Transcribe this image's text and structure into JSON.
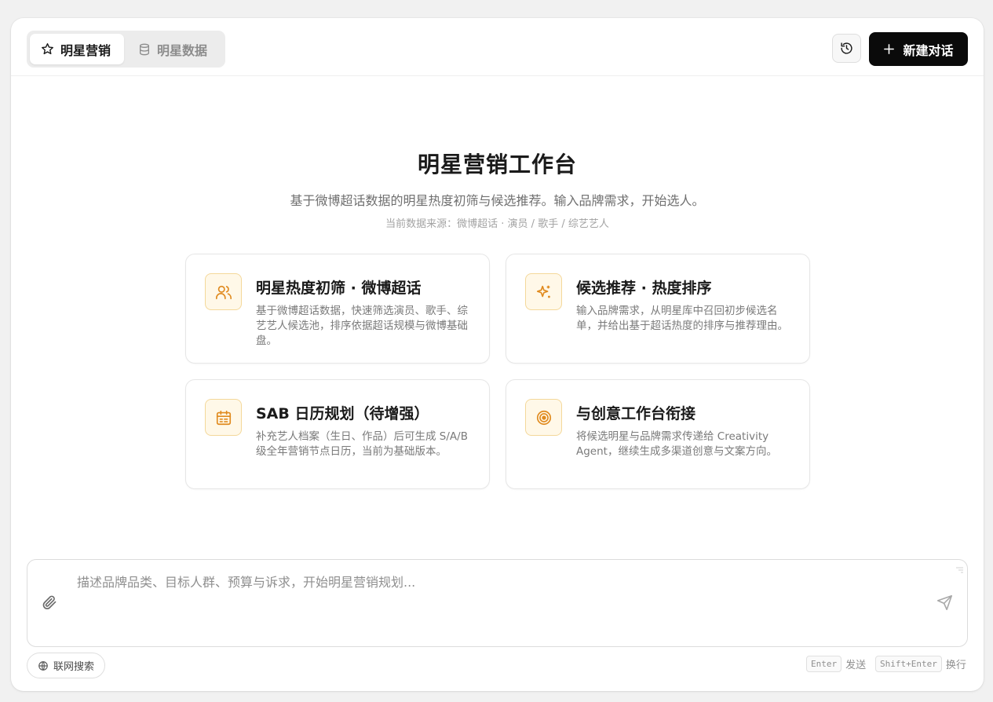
{
  "tabs": [
    {
      "label": "明星营销",
      "icon": "star-icon",
      "active": true
    },
    {
      "label": "明星数据",
      "icon": "database-icon",
      "active": false
    }
  ],
  "header": {
    "history_icon": "history-icon",
    "new_chat_label": "新建对话"
  },
  "hero": {
    "title": "明星营销工作台",
    "subtitle": "基于微博超话数据的明星热度初筛与候选推荐。输入品牌需求，开始选人。",
    "source": "当前数据来源：微博超话 · 演员 / 歌手 / 综艺艺人"
  },
  "cards": [
    {
      "title": "明星热度初筛 · 微博超话",
      "desc": "基于微博超话数据，快速筛选演员、歌手、综艺艺人候选池，排序依据超话规模与微博基础盘。",
      "icon": "users-icon"
    },
    {
      "title": "候选推荐 · 热度排序",
      "desc": "输入品牌需求，从明星库中召回初步候选名单，并给出基于超话热度的排序与推荐理由。",
      "icon": "sparkles-icon"
    },
    {
      "title": "SAB 日历规划（待增强）",
      "desc": "补充艺人档案（生日、作品）后可生成 S/A/B 级全年营销节点日历，当前为基础版本。",
      "icon": "calendar-icon"
    },
    {
      "title": "与创意工作台衔接",
      "desc": "将候选明星与品牌需求传递给 Creativity Agent，继续生成多渠道创意与文案方向。",
      "icon": "target-icon"
    }
  ],
  "composer": {
    "placeholder": "描述品牌品类、目标人群、预算与诉求，开始明星营销规划...",
    "web_search_label": "联网搜索",
    "enter_key": "Enter",
    "enter_hint": "发送",
    "shift_enter_key": "Shift+Enter",
    "shift_enter_hint": "换行"
  },
  "colors": {
    "accent": "#e08a1e",
    "icon_bg": "#fff8e8",
    "primary_button": "#0a0a0a"
  }
}
